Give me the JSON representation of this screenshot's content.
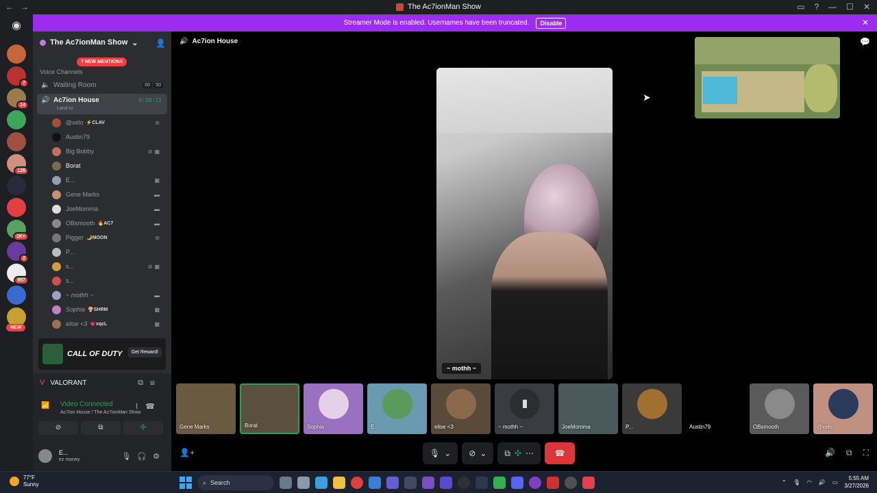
{
  "window": {
    "title": "The Ac7ionMan Show",
    "back": "←",
    "forward": "→"
  },
  "banner": {
    "text": "Streamer Mode is enabled. Usernames have been truncated.",
    "button": "Disable"
  },
  "servers": {
    "badges": [
      "7",
      "14",
      "126",
      "1K+",
      "2",
      "957"
    ],
    "new_label": "NEW"
  },
  "sidebar": {
    "server_name": "The Ac7ionMan Show",
    "mentions": "7 NEW MENTIONS",
    "voice_category": "Voice Channels",
    "waiting_room": {
      "name": "Waiting Room",
      "count_a": "00",
      "count_b": "50"
    },
    "active_channel": {
      "name": "Ac7ion House",
      "sub": "Land-io",
      "time": "9:29:11"
    },
    "members": [
      {
        "name": "@xelo",
        "tag": "⚡CLAV"
      },
      {
        "name": "Austin79",
        "tag": ""
      },
      {
        "name": "Big Bobby",
        "tag": ""
      },
      {
        "name": "Borat",
        "tag": ""
      },
      {
        "name": "E...",
        "tag": ""
      },
      {
        "name": "Gene Marks",
        "tag": ""
      },
      {
        "name": "JoeMomma",
        "tag": ""
      },
      {
        "name": "OBsmooth",
        "tag": "🔥AC7"
      },
      {
        "name": "Pigger",
        "tag": "🌙MOON"
      },
      {
        "name": "P...",
        "tag": ""
      },
      {
        "name": "s...",
        "tag": ""
      },
      {
        "name": "s...",
        "tag": ""
      },
      {
        "name": "~ mothh ~",
        "tag": ""
      },
      {
        "name": "Sophia",
        "tag": "🍄SHRM"
      },
      {
        "name": "elise <3",
        "tag": "💗xqcL"
      }
    ],
    "promo": {
      "title": "CALL OF DUTY",
      "button": "Get Reward!"
    }
  },
  "panel": {
    "game": "VALORANT",
    "status": "Video Connected",
    "status_sub": "Ac7ion House / The Ac7ionMan Show",
    "user": {
      "name": "E...",
      "status": "ez money"
    }
  },
  "main": {
    "channel": "Ac7ion House",
    "stage_name": "~ mothh ~",
    "tiles": [
      "Gene Marks",
      "Borat",
      "Sophia",
      "E...",
      "elise <3",
      "~ mothh ~",
      "JoeMomma",
      "P...",
      "Austin79",
      "OBsmooth",
      "@xelo"
    ]
  },
  "taskbar": {
    "temp": "77°F",
    "weather": "Sunny",
    "search": "Search",
    "time": "5:55 AM",
    "date": "3/27/2026"
  }
}
